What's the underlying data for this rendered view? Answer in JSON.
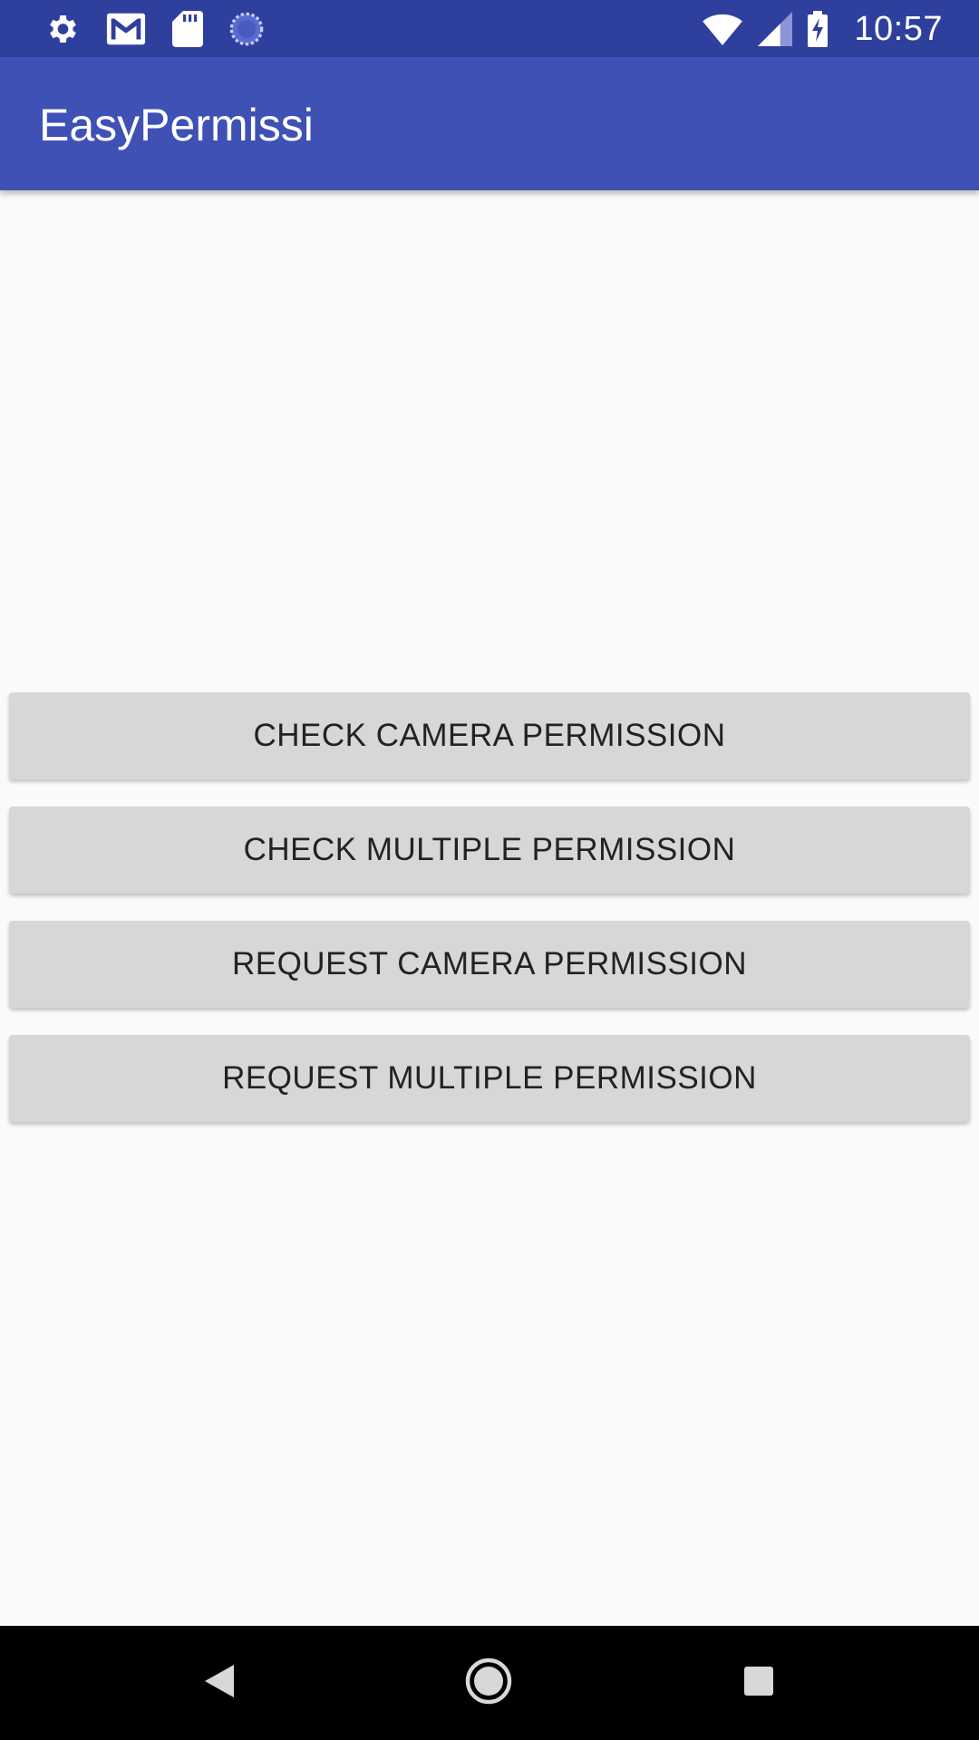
{
  "status_bar": {
    "time": "10:57",
    "left_icons": [
      "gear-icon",
      "gmail-icon",
      "sd-card-icon",
      "sync-icon"
    ],
    "right_icons": [
      "wifi-icon",
      "signal-icon",
      "battery-charging-icon"
    ],
    "background_color": "#2f3f9e"
  },
  "app_bar": {
    "title": "EasyPermissi",
    "background_color": "#3f51b5"
  },
  "buttons": [
    {
      "label": "CHECK CAMERA PERMISSION"
    },
    {
      "label": "CHECK MULTIPLE PERMISSION"
    },
    {
      "label": "REQUEST CAMERA PERMISSION"
    },
    {
      "label": "REQUEST MULTIPLE PERMISSION"
    }
  ],
  "nav_bar": {
    "icons": [
      "back-icon",
      "home-icon",
      "recents-icon"
    ]
  }
}
